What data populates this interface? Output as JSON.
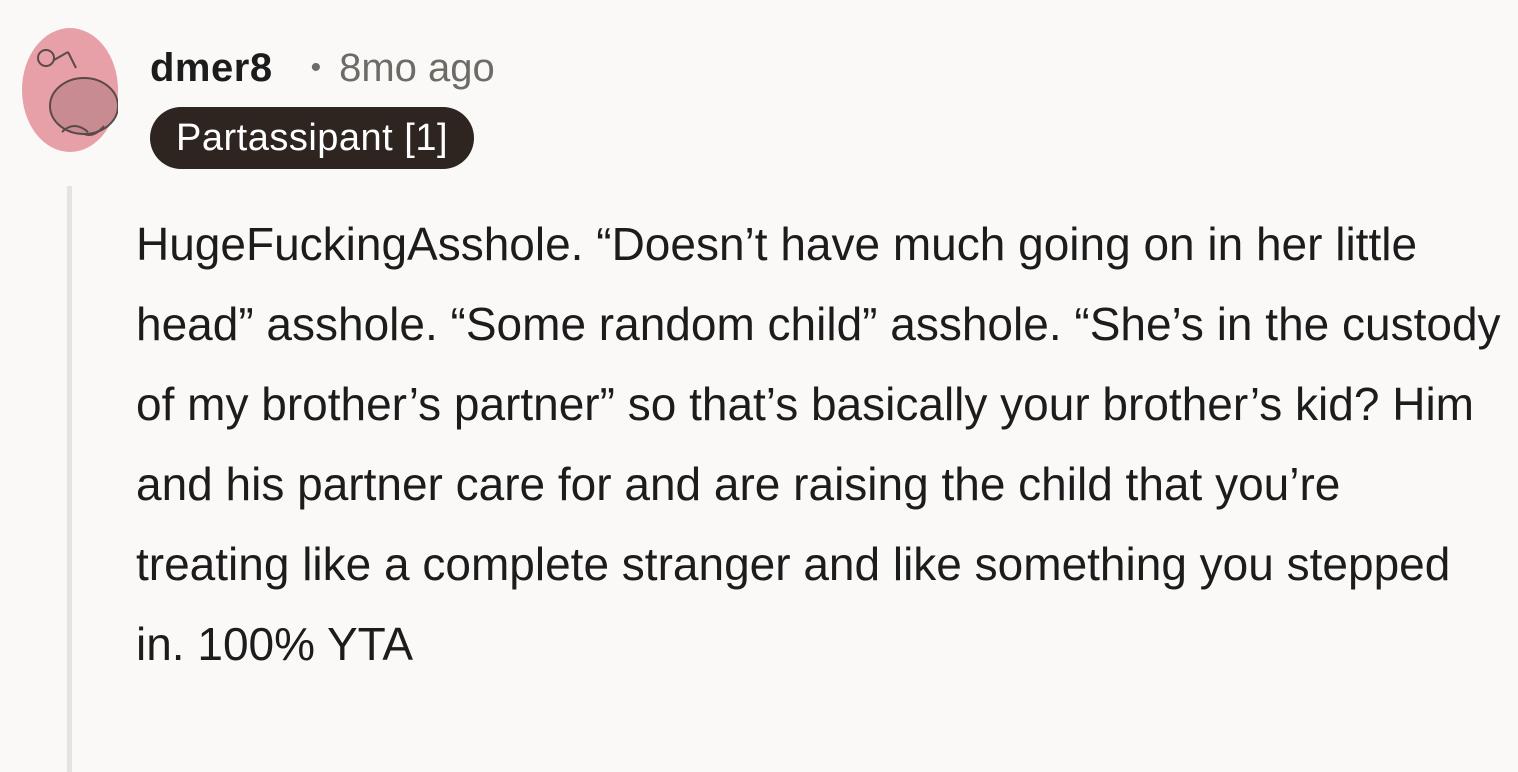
{
  "comment": {
    "username": "dmer8",
    "separator": "•",
    "timestamp": "8mo ago",
    "flair": "Partassipant [1]",
    "avatar_icon": "reddit-snoo-avatar-icon",
    "avatar_color": "#E8A0A8",
    "flair_color": "#2F2520",
    "body": "HugeFuckingAsshole. “Doesn’t have much going on in her little head” asshole. “Some random child” asshole. “She’s in the custody of my brother’s partner” so that’s basically your brother’s kid? Him and his partner care for and are raising the child that you’re treating like a complete stranger and like something you stepped in. 100% YTA"
  }
}
